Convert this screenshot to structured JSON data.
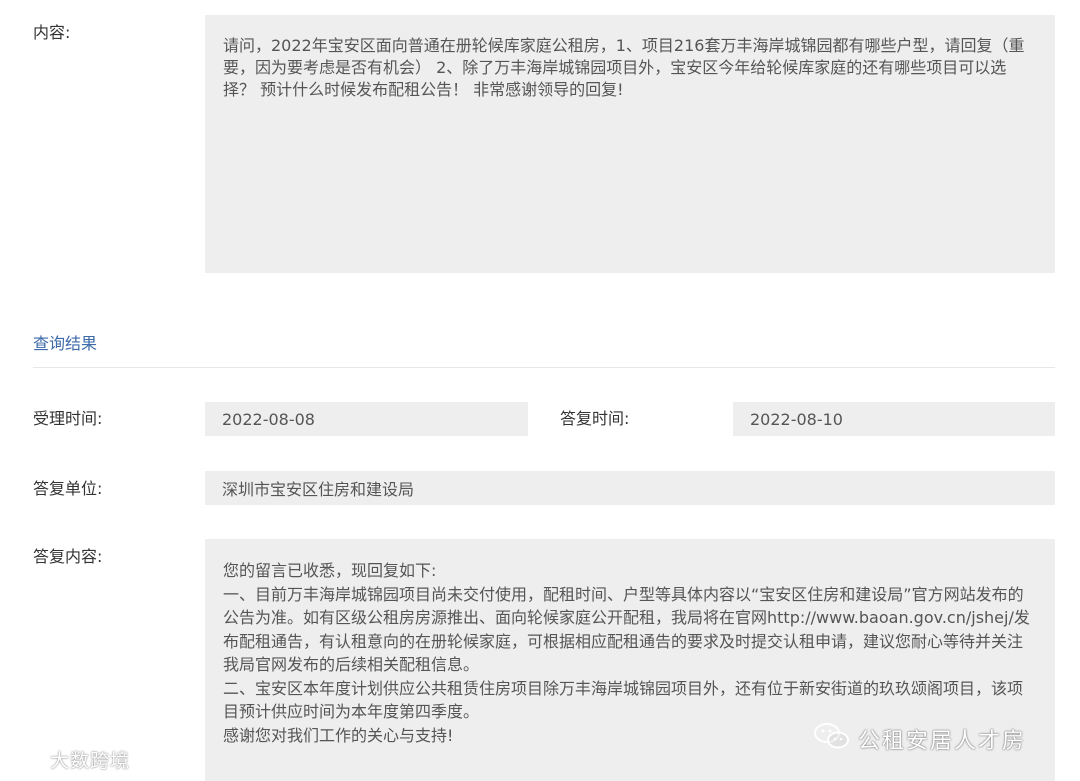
{
  "content": {
    "label": "内容:",
    "text": "请问，2022年宝安区面向普通在册轮候库家庭公租房，1、项目216套万丰海岸城锦园都有哪些户型，请回复（重要，因为要考虑是否有机会） 2、除了万丰海岸城锦园项目外，宝安区今年给轮候库家庭的还有哪些项目可以选择？ 预计什么时候发布配租公告！ 非常感谢领导的回复!"
  },
  "result": {
    "section_title": "查询结果",
    "accept_time_label": "受理时间:",
    "accept_time": "2022-08-08",
    "reply_time_label": "答复时间:",
    "reply_time": "2022-08-10",
    "reply_unit_label": "答复单位:",
    "reply_unit": "深圳市宝安区住房和建设局",
    "reply_content_label": "答复内容:",
    "reply_lines": [
      "您的留言已收悉，现回复如下:",
      "一、目前万丰海岸城锦园项目尚未交付使用，配租时间、户型等具体内容以“宝安区住房和建设局”官方网站发布的公告为准。如有区级公租房房源推出、面向轮候家庭公开配租，我局将在官网http://www.baoan.gov.cn/jshej/发布配租通告，有认租意向的在册轮候家庭，可根据相应配租通告的要求及时提交认租申请，建议您耐心等待并关注我局官网发布的后续相关配租信息。",
      "二、宝安区本年度计划供应公共租赁住房项目除万丰海岸城锦园项目外，还有位于新安街道的玖玖颂阁项目，该项目预计供应时间为本年度第四季度。",
      "感谢您对我们工作的关心与支持!"
    ]
  },
  "watermarks": {
    "left": "大数跨境",
    "right": "公租安居人才房",
    "left_icon": "weibo-icon",
    "right_icon": "wechat-icon"
  },
  "colors": {
    "section_title": "#3d6aa8",
    "box_background": "#eeeeee"
  }
}
